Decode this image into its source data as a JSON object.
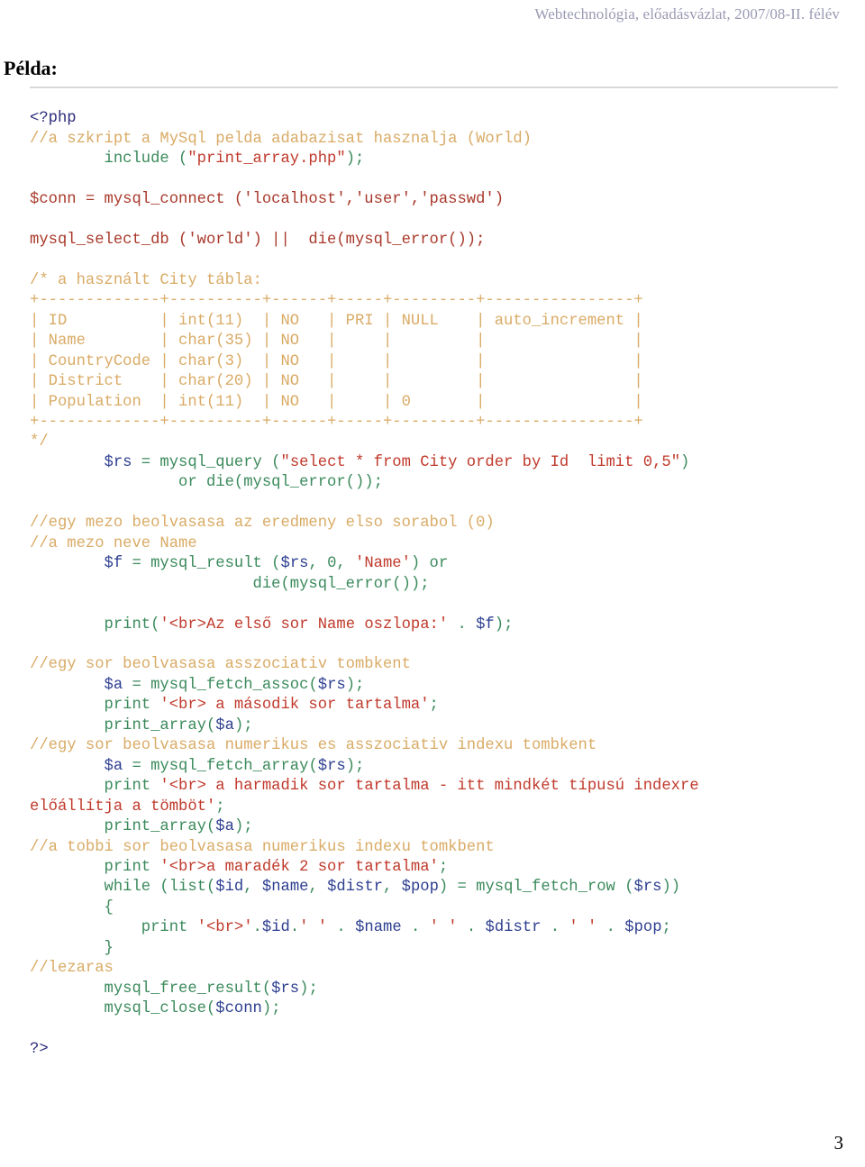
{
  "header": {
    "running_head": "Webtechnológia, előadásvázlat, 2007/08-II. félév"
  },
  "title": "Példa:",
  "page_number": "3",
  "colors": {
    "running_head": "#9a9ab4",
    "rule": "#d9d9d9",
    "php_tag": "#2c2c7a",
    "comment": "#d9ab66",
    "function": "#3b8a5c",
    "string": "#c0392b",
    "variable": "#2c3e8f",
    "plain_code": "#a8392b"
  },
  "code": {
    "language": "php",
    "lines": [
      {
        "id": "l01",
        "segments": [
          {
            "t": "<?php",
            "c": "tag"
          }
        ]
      },
      {
        "id": "l02",
        "segments": [
          {
            "t": "//a szkript a MySql pelda adabazisat hasznalja (World)",
            "c": "cmt"
          }
        ]
      },
      {
        "id": "l03",
        "segments": [
          {
            "t": "        include (",
            "c": "fn"
          },
          {
            "t": "\"print_array.php\"",
            "c": "str"
          },
          {
            "t": ");",
            "c": "fn"
          }
        ]
      },
      {
        "id": "l04",
        "segments": [
          {
            "t": "",
            "c": "plain"
          }
        ]
      },
      {
        "id": "l05",
        "segments": [
          {
            "t": "$conn = mysql_connect ('localhost','user','passwd')",
            "c": "plain"
          }
        ]
      },
      {
        "id": "l06",
        "segments": [
          {
            "t": "",
            "c": "plain"
          }
        ]
      },
      {
        "id": "l07",
        "segments": [
          {
            "t": "mysql_select_db ('world') ||  die(mysql_error());",
            "c": "plain"
          }
        ]
      },
      {
        "id": "l08",
        "segments": [
          {
            "t": "",
            "c": "plain"
          }
        ]
      },
      {
        "id": "l09",
        "segments": [
          {
            "t": "/* a használt City tábla:",
            "c": "cmt"
          }
        ]
      },
      {
        "id": "l10",
        "segments": [
          {
            "t": "+-------------+----------+------+-----+---------+----------------+",
            "c": "cmt"
          }
        ]
      },
      {
        "id": "l11",
        "segments": [
          {
            "t": "| ID          | int(11)  | NO   | PRI | NULL    | auto_increment |",
            "c": "cmt"
          }
        ]
      },
      {
        "id": "l12",
        "segments": [
          {
            "t": "| Name        | char(35) | NO   |     |         |                |",
            "c": "cmt"
          }
        ]
      },
      {
        "id": "l13",
        "segments": [
          {
            "t": "| CountryCode | char(3)  | NO   |     |         |                |",
            "c": "cmt"
          }
        ]
      },
      {
        "id": "l14",
        "segments": [
          {
            "t": "| District    | char(20) | NO   |     |         |                |",
            "c": "cmt"
          }
        ]
      },
      {
        "id": "l15",
        "segments": [
          {
            "t": "| Population  | int(11)  | NO   |     | 0       |                |",
            "c": "cmt"
          }
        ]
      },
      {
        "id": "l16",
        "segments": [
          {
            "t": "+-------------+----------+------+-----+---------+----------------+",
            "c": "cmt"
          }
        ]
      },
      {
        "id": "l17",
        "segments": [
          {
            "t": "*/",
            "c": "cmt"
          }
        ]
      },
      {
        "id": "l18",
        "segments": [
          {
            "t": "        ",
            "c": "plain"
          },
          {
            "t": "$rs",
            "c": "var"
          },
          {
            "t": " = mysql_query (",
            "c": "fn"
          },
          {
            "t": "\"select * from City order by Id  limit 0,5\"",
            "c": "str"
          },
          {
            "t": ")",
            "c": "fn"
          }
        ]
      },
      {
        "id": "l19",
        "segments": [
          {
            "t": "                or die(mysql_error());",
            "c": "fn"
          }
        ]
      },
      {
        "id": "l20",
        "segments": [
          {
            "t": "",
            "c": "plain"
          }
        ]
      },
      {
        "id": "l21",
        "segments": [
          {
            "t": "//egy mezo beolvasasa az eredmeny elso sorabol (0)",
            "c": "cmt"
          }
        ]
      },
      {
        "id": "l22",
        "segments": [
          {
            "t": "//a mezo neve Name",
            "c": "cmt"
          }
        ]
      },
      {
        "id": "l23",
        "segments": [
          {
            "t": "        ",
            "c": "plain"
          },
          {
            "t": "$f",
            "c": "var"
          },
          {
            "t": " = mysql_result (",
            "c": "fn"
          },
          {
            "t": "$rs",
            "c": "var"
          },
          {
            "t": ", 0, ",
            "c": "fn"
          },
          {
            "t": "'Name'",
            "c": "str"
          },
          {
            "t": ") or",
            "c": "fn"
          }
        ]
      },
      {
        "id": "l24",
        "segments": [
          {
            "t": "                        die(mysql_error());",
            "c": "fn"
          }
        ]
      },
      {
        "id": "l25",
        "segments": [
          {
            "t": "",
            "c": "plain"
          }
        ]
      },
      {
        "id": "l26",
        "segments": [
          {
            "t": "        print(",
            "c": "fn"
          },
          {
            "t": "'<br>Az első sor Name oszlopa:'",
            "c": "str"
          },
          {
            "t": " . ",
            "c": "fn"
          },
          {
            "t": "$f",
            "c": "var"
          },
          {
            "t": ");",
            "c": "fn"
          }
        ]
      },
      {
        "id": "l27",
        "segments": [
          {
            "t": "",
            "c": "plain"
          }
        ]
      },
      {
        "id": "l28",
        "segments": [
          {
            "t": "//egy sor beolvasasa asszociativ tombkent",
            "c": "cmt"
          }
        ]
      },
      {
        "id": "l29",
        "segments": [
          {
            "t": "        ",
            "c": "plain"
          },
          {
            "t": "$a",
            "c": "var"
          },
          {
            "t": " = mysql_fetch_assoc(",
            "c": "fn"
          },
          {
            "t": "$rs",
            "c": "var"
          },
          {
            "t": ");",
            "c": "fn"
          }
        ]
      },
      {
        "id": "l30",
        "segments": [
          {
            "t": "        print ",
            "c": "fn"
          },
          {
            "t": "'<br> a második sor tartalma'",
            "c": "str"
          },
          {
            "t": ";",
            "c": "fn"
          }
        ]
      },
      {
        "id": "l31",
        "segments": [
          {
            "t": "        print_array(",
            "c": "fn"
          },
          {
            "t": "$a",
            "c": "var"
          },
          {
            "t": ");",
            "c": "fn"
          }
        ]
      },
      {
        "id": "l32",
        "segments": [
          {
            "t": "//egy sor beolvasasa numerikus es asszociativ indexu tombkent",
            "c": "cmt"
          }
        ]
      },
      {
        "id": "l33",
        "segments": [
          {
            "t": "        ",
            "c": "plain"
          },
          {
            "t": "$a",
            "c": "var"
          },
          {
            "t": " = mysql_fetch_array(",
            "c": "fn"
          },
          {
            "t": "$rs",
            "c": "var"
          },
          {
            "t": ");",
            "c": "fn"
          }
        ]
      },
      {
        "id": "l34",
        "segments": [
          {
            "t": "        print ",
            "c": "fn"
          },
          {
            "t": "'<br> a harmadik sor tartalma - itt mindkét típusú indexre",
            "c": "str"
          }
        ]
      },
      {
        "id": "l35",
        "segments": [
          {
            "t": "előállítja a tömböt'",
            "c": "str"
          },
          {
            "t": ";",
            "c": "fn"
          }
        ]
      },
      {
        "id": "l36",
        "segments": [
          {
            "t": "        print_array(",
            "c": "fn"
          },
          {
            "t": "$a",
            "c": "var"
          },
          {
            "t": ");",
            "c": "fn"
          }
        ]
      },
      {
        "id": "l37",
        "segments": [
          {
            "t": "//a tobbi sor beolvasasa numerikus indexu tomkbent",
            "c": "cmt"
          }
        ]
      },
      {
        "id": "l38",
        "segments": [
          {
            "t": "        print ",
            "c": "fn"
          },
          {
            "t": "'<br>a maradék 2 sor tartalma'",
            "c": "str"
          },
          {
            "t": ";",
            "c": "fn"
          }
        ]
      },
      {
        "id": "l39",
        "segments": [
          {
            "t": "        while (list(",
            "c": "fn"
          },
          {
            "t": "$id",
            "c": "var"
          },
          {
            "t": ", ",
            "c": "fn"
          },
          {
            "t": "$name",
            "c": "var"
          },
          {
            "t": ", ",
            "c": "fn"
          },
          {
            "t": "$distr",
            "c": "var"
          },
          {
            "t": ", ",
            "c": "fn"
          },
          {
            "t": "$pop",
            "c": "var"
          },
          {
            "t": ") = mysql_fetch_row (",
            "c": "fn"
          },
          {
            "t": "$rs",
            "c": "var"
          },
          {
            "t": "))",
            "c": "fn"
          }
        ]
      },
      {
        "id": "l40",
        "segments": [
          {
            "t": "        {",
            "c": "fn"
          }
        ]
      },
      {
        "id": "l41",
        "segments": [
          {
            "t": "            print ",
            "c": "fn"
          },
          {
            "t": "'<br>'",
            "c": "str"
          },
          {
            "t": ".",
            "c": "fn"
          },
          {
            "t": "$id",
            "c": "var"
          },
          {
            "t": ".",
            "c": "fn"
          },
          {
            "t": "' '",
            "c": "str"
          },
          {
            "t": " . ",
            "c": "fn"
          },
          {
            "t": "$name",
            "c": "var"
          },
          {
            "t": " . ",
            "c": "fn"
          },
          {
            "t": "' '",
            "c": "str"
          },
          {
            "t": " . ",
            "c": "fn"
          },
          {
            "t": "$distr",
            "c": "var"
          },
          {
            "t": " . ",
            "c": "fn"
          },
          {
            "t": "' '",
            "c": "str"
          },
          {
            "t": " . ",
            "c": "fn"
          },
          {
            "t": "$pop",
            "c": "var"
          },
          {
            "t": ";",
            "c": "fn"
          }
        ]
      },
      {
        "id": "l42",
        "segments": [
          {
            "t": "        }",
            "c": "fn"
          }
        ]
      },
      {
        "id": "l43",
        "segments": [
          {
            "t": "//lezaras",
            "c": "cmt"
          }
        ]
      },
      {
        "id": "l44",
        "segments": [
          {
            "t": "        mysql_free_result(",
            "c": "fn"
          },
          {
            "t": "$rs",
            "c": "var"
          },
          {
            "t": ");",
            "c": "fn"
          }
        ]
      },
      {
        "id": "l45",
        "segments": [
          {
            "t": "        mysql_close(",
            "c": "fn"
          },
          {
            "t": "$conn",
            "c": "var"
          },
          {
            "t": ");",
            "c": "fn"
          }
        ]
      },
      {
        "id": "l46",
        "segments": [
          {
            "t": "",
            "c": "plain"
          }
        ]
      },
      {
        "id": "l47",
        "segments": [
          {
            "t": "?>",
            "c": "tag"
          }
        ]
      }
    ]
  }
}
